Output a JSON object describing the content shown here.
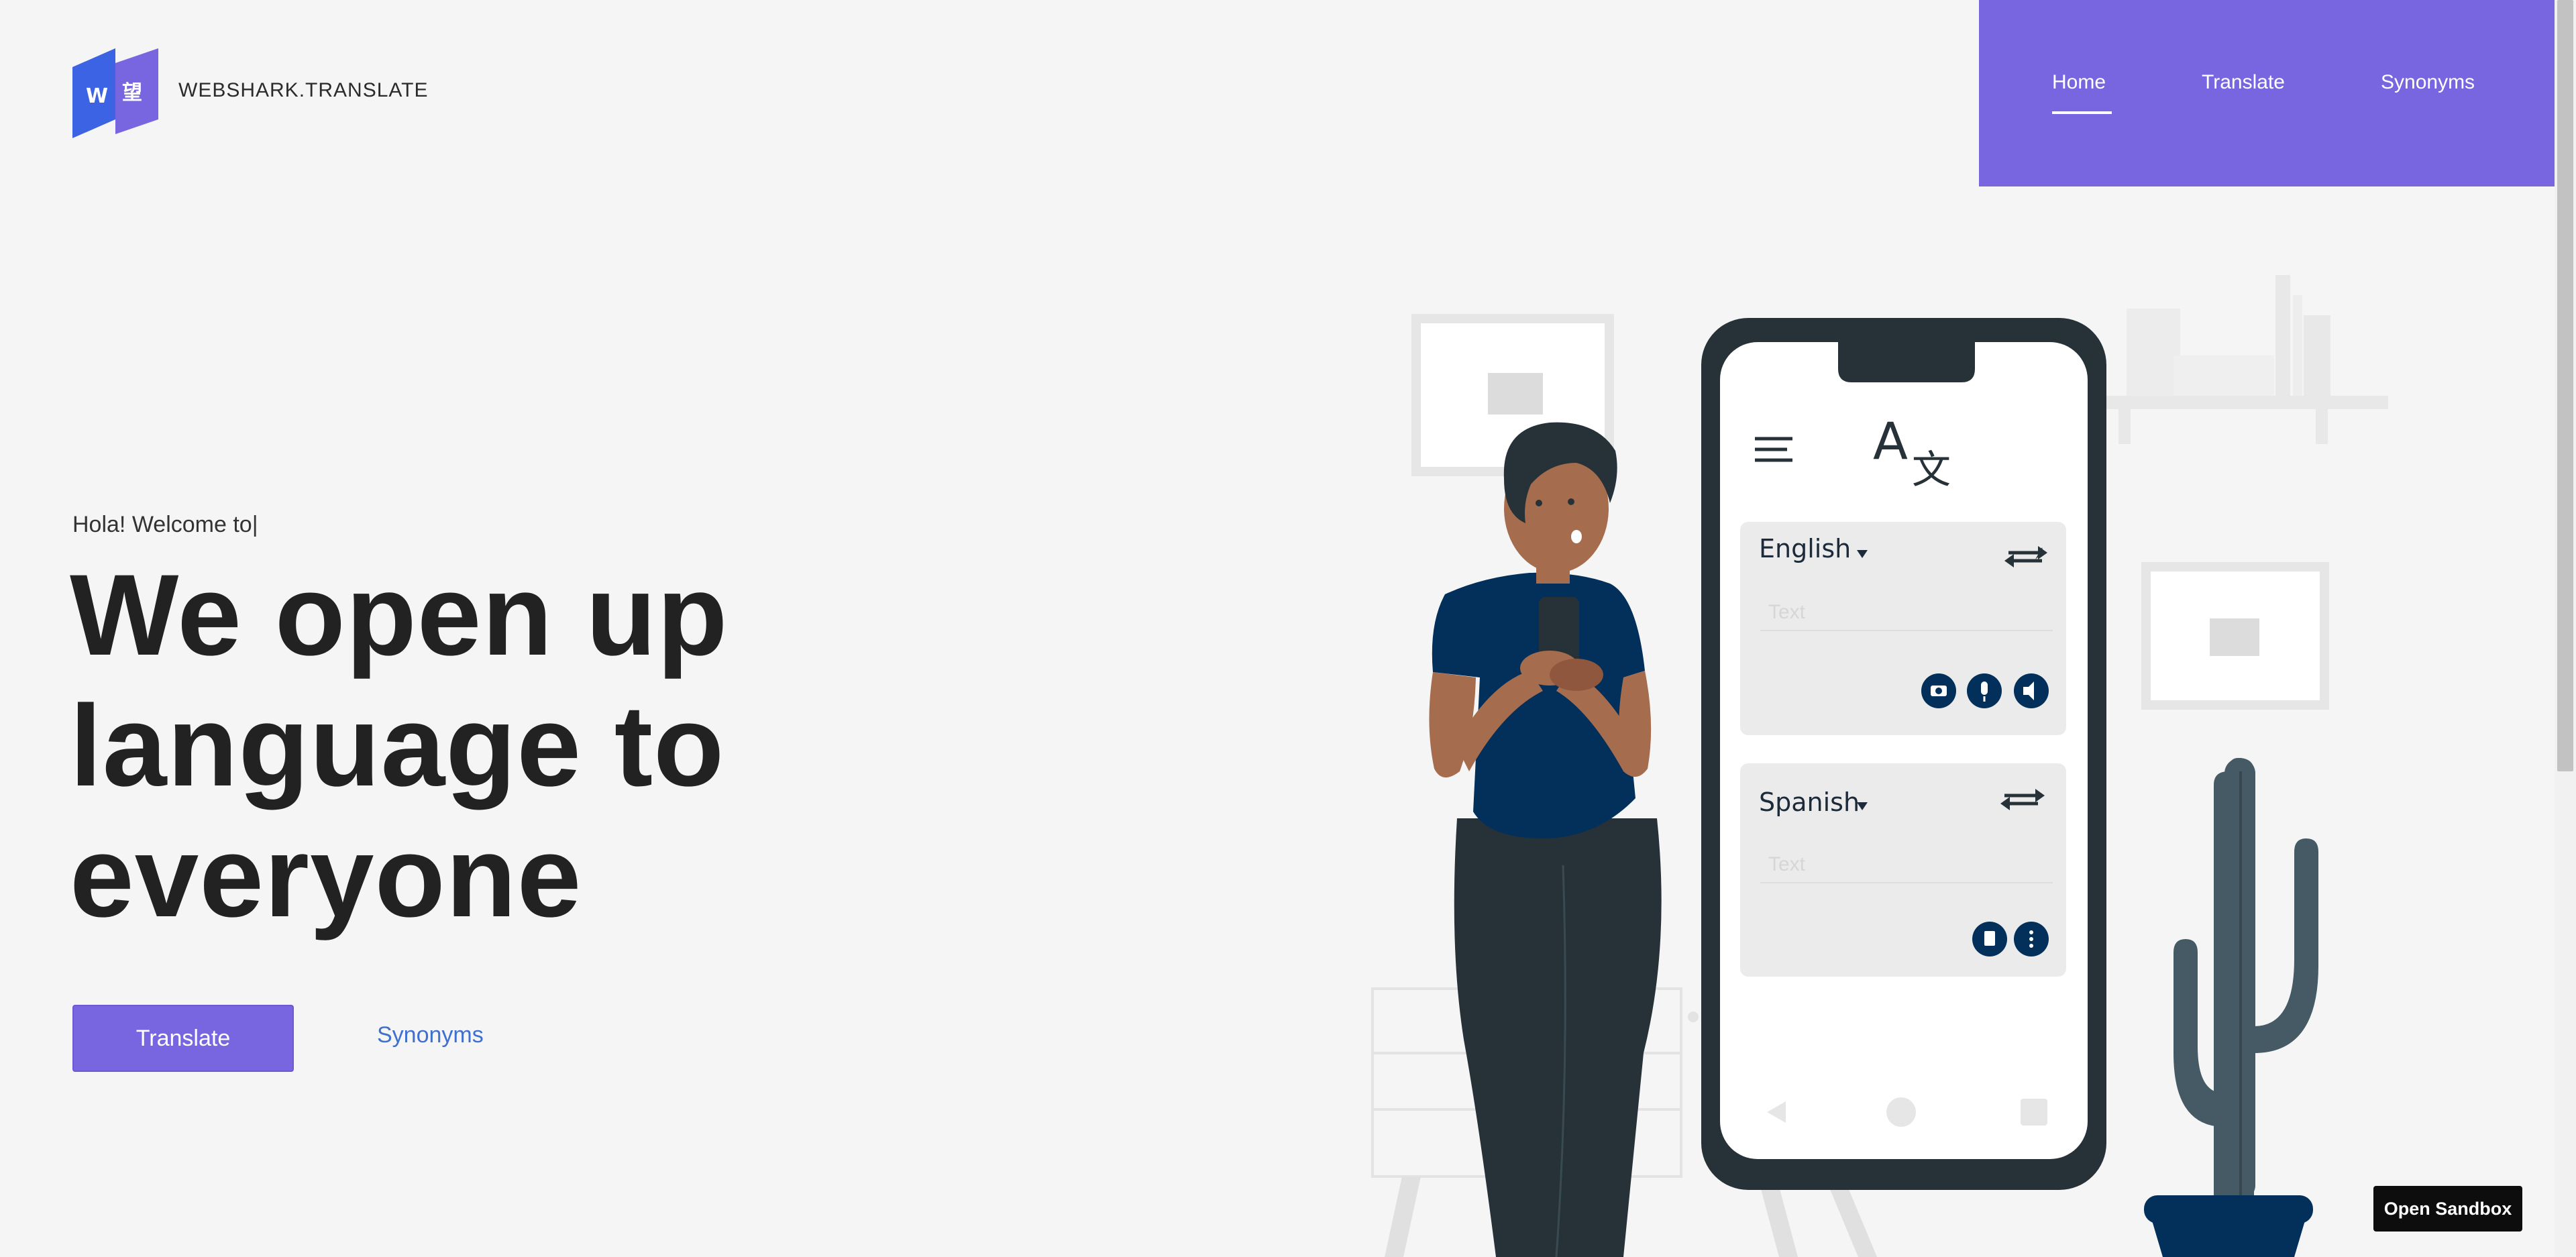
{
  "brand": {
    "logo_letter_left": "W",
    "logo_letter_right": "望",
    "name": "WEBSHARK.TRANSLATE"
  },
  "nav": {
    "items": [
      {
        "label": "Home",
        "active": true
      },
      {
        "label": "Translate",
        "active": false
      },
      {
        "label": "Synonyms",
        "active": false
      }
    ]
  },
  "hero": {
    "kicker": "Hola! Welcome to|",
    "title_lines": [
      "We open up",
      "language to",
      "everyone"
    ],
    "primary_button": "Translate",
    "secondary_link": "Synonyms"
  },
  "phone": {
    "source_language": "English",
    "target_language": "Spanish",
    "source_placeholder": "Text",
    "target_placeholder": "Text",
    "source_icons": [
      "camera-icon",
      "microphone-icon",
      "speaker-icon"
    ],
    "target_icons": [
      "copy-icon",
      "more-vertical-icon"
    ]
  },
  "sandbox": {
    "label": "Open Sandbox"
  },
  "colors": {
    "accent": "#7866e0",
    "navy": "#03305a",
    "dark": "#263238",
    "background": "#f5f5f5"
  }
}
